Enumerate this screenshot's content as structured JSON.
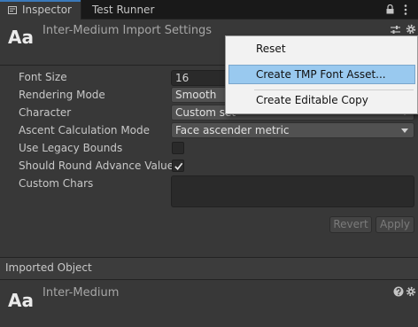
{
  "tabs": {
    "inspector": "Inspector",
    "test_runner": "Test Runner"
  },
  "header": {
    "icon_text": "Aa",
    "title": "Inter-Medium Import Settings"
  },
  "properties": {
    "font_size": {
      "label": "Font Size",
      "value": "16"
    },
    "rendering_mode": {
      "label": "Rendering Mode",
      "value": "Smooth"
    },
    "character": {
      "label": "Character",
      "value": "Custom set"
    },
    "ascent_mode": {
      "label": "Ascent Calculation Mode",
      "value": "Face ascender metric"
    },
    "legacy_bounds": {
      "label": "Use Legacy Bounds",
      "checked": false
    },
    "round_advance": {
      "label": "Should Round Advance Value",
      "checked": true
    },
    "custom_chars": {
      "label": "Custom Chars",
      "value": ""
    }
  },
  "buttons": {
    "revert": "Revert",
    "apply": "Apply"
  },
  "imported_object": {
    "section_label": "Imported Object",
    "icon_text": "Aa",
    "name": "Inter-Medium"
  },
  "context_menu": {
    "items": [
      "Reset",
      "Create TMP Font Asset...",
      "Create Editable Copy"
    ],
    "highlighted": "Create TMP Font Asset..."
  },
  "colors": {
    "panel_bg": "#383838",
    "tab_bar_bg": "#191919",
    "active_tab_accent": "#3a79bb",
    "menu_highlight": "#99c9ef"
  },
  "icons": [
    "inspector-icon",
    "lock-icon",
    "kebab-menu-icon",
    "preset-icon",
    "gear-icon",
    "help-icon",
    "checkmark-icon",
    "dropdown-arrow-icon"
  ]
}
